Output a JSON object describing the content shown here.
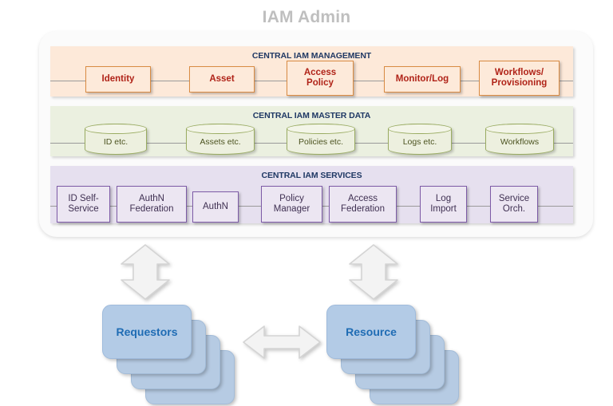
{
  "title": "IAM Admin",
  "panel": {
    "bands": [
      {
        "id": "management",
        "title": "CENTRAL IAM MANAGEMENT",
        "nodes": [
          {
            "label": "Identity"
          },
          {
            "label": "Asset"
          },
          {
            "label": "Access\nPolicy"
          },
          {
            "label": "Monitor/Log"
          },
          {
            "label": "Workflows/\nProvisioning"
          }
        ]
      },
      {
        "id": "masterdata",
        "title": "CENTRAL IAM MASTER DATA",
        "nodes": [
          {
            "label": "ID etc."
          },
          {
            "label": "Assets etc."
          },
          {
            "label": "Policies  etc."
          },
          {
            "label": "Logs etc."
          },
          {
            "label": "Workflows"
          }
        ]
      },
      {
        "id": "services",
        "title": "CENTRAL IAM SERVICES",
        "nodes": [
          {
            "label": "ID Self-\nService"
          },
          {
            "label": "AuthN\nFederation"
          },
          {
            "label": "AuthN"
          },
          {
            "label": "Policy\nManager"
          },
          {
            "label": "Access\nFederation"
          },
          {
            "label": "Log\nImport"
          },
          {
            "label": "Service\nOrch."
          }
        ]
      }
    ]
  },
  "actors": [
    {
      "id": "requestors",
      "label": "Requestors"
    },
    {
      "id": "resource",
      "label": "Resource"
    }
  ],
  "arrows": [
    {
      "id": "requestors-link",
      "direction": "vertical-bidirectional"
    },
    {
      "id": "resource-link",
      "direction": "vertical-bidirectional"
    },
    {
      "id": "requestors-resource-link",
      "direction": "horizontal-bidirectional"
    }
  ],
  "colors": {
    "title_text": "#bfbfbf",
    "band_title_text": "#1f3864",
    "management_band_bg": "#fde9d9",
    "management_box_bg": "#fdeada",
    "management_box_border": "#d98b43",
    "management_box_text": "#b02318",
    "masterdata_band_bg": "#ebf0e0",
    "masterdata_cyl_bg": "#edf0df",
    "masterdata_cyl_border": "#9aac62",
    "masterdata_cyl_text": "#4c5320",
    "services_band_bg": "#e6e0ef",
    "services_box_bg": "#ece6f2",
    "services_box_border": "#7d5ba6",
    "services_box_text": "#3f3052",
    "actor_card_bg": "#b3cbe6",
    "actor_label_text": "#1f6cb4",
    "arrow_fill": "#f2f2f2",
    "arrow_stroke": "#d0d0d0",
    "panel_bg": "#fbfbfb"
  }
}
